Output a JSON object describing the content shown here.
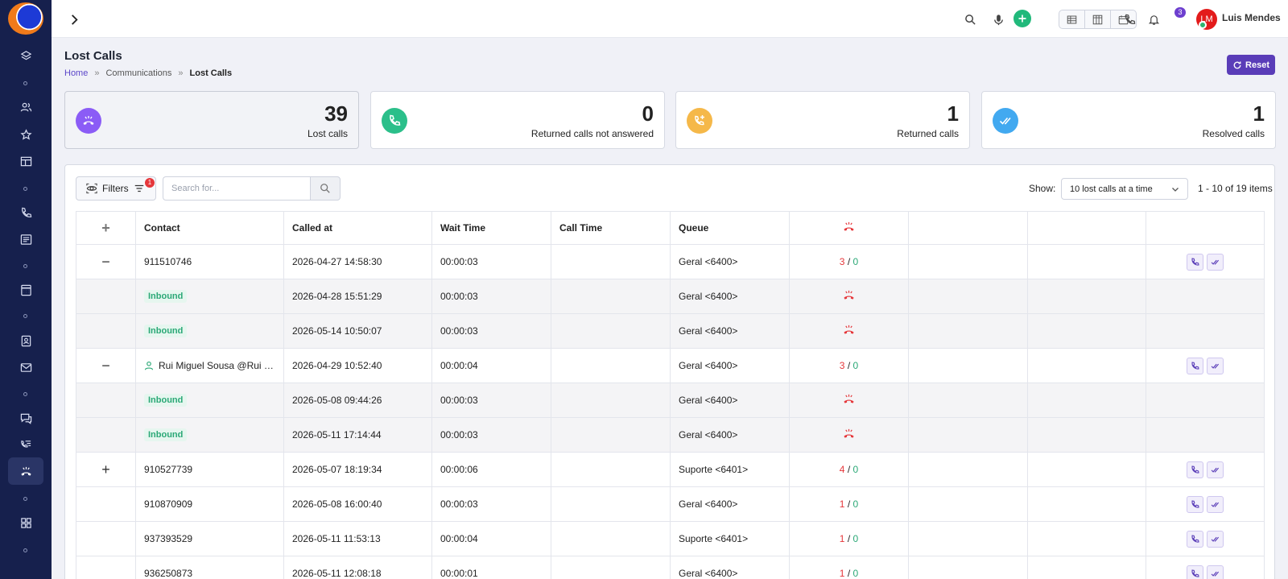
{
  "colors": {
    "sidebar": "#16204d",
    "accent": "#5a3db8",
    "lost": "#e5373b",
    "returned": "#2aa876"
  },
  "sidebar": {
    "items": [
      {
        "name": "layers-icon"
      },
      {
        "name": "users-icon"
      },
      {
        "name": "star-icon"
      },
      {
        "name": "table-icon"
      },
      {
        "name": "phone-icon"
      },
      {
        "name": "list-icon"
      },
      {
        "name": "calculator-icon"
      },
      {
        "name": "contacts-icon"
      },
      {
        "name": "mail-icon"
      },
      {
        "name": "chat-icon"
      },
      {
        "name": "call-list-icon"
      },
      {
        "name": "lost-calls-icon"
      },
      {
        "name": "dashboard-icon"
      }
    ]
  },
  "topbar": {
    "notification_count": "3",
    "avatar_initials": "LM",
    "user_name": "Luis Mendes"
  },
  "page": {
    "title": "Lost Calls",
    "breadcrumb": {
      "home": "Home",
      "section": "Communications",
      "current": "Lost Calls"
    },
    "reset_label": "Reset"
  },
  "stats": [
    {
      "value": "39",
      "label": "Lost calls",
      "icon": "phone-down-icon",
      "color": "#8b5cf6"
    },
    {
      "value": "0",
      "label": "Returned calls not answered",
      "icon": "phone-icon",
      "color": "#2bbf8a"
    },
    {
      "value": "1",
      "label": "Returned calls",
      "icon": "phone-plus-icon",
      "color": "#f5b849"
    },
    {
      "value": "1",
      "label": "Resolved calls",
      "icon": "double-check-icon",
      "color": "#42a9f0"
    }
  ],
  "toolbar": {
    "filters_label": "Filters",
    "filters_count": "1",
    "search_placeholder": "Search for...",
    "show_label": "Show:",
    "show_value": "10 lost calls at a time",
    "range": "1 - 10 of 19 items"
  },
  "table": {
    "columns": {
      "contact": "Contact",
      "called_at": "Called at",
      "wait_time": "Wait Time",
      "call_time": "Call Time",
      "queue": "Queue"
    },
    "expand_all": "+",
    "inbound_label": "Inbound",
    "rows": [
      {
        "expander": "−",
        "contact": "911510746",
        "called_at": "2026-04-27 14:58:30",
        "wait": "00:00:03",
        "queue": "Geral <6400>",
        "lost": "3",
        "returned": "0"
      },
      {
        "sub": true,
        "called_at": "2026-04-28 15:51:29",
        "wait": "00:00:03",
        "queue": "Geral <6400>"
      },
      {
        "sub": true,
        "called_at": "2026-05-14 10:50:07",
        "wait": "00:00:03",
        "queue": "Geral <6400>"
      },
      {
        "expander": "−",
        "contact": "Rui Miguel Sousa @Rui Mi...",
        "contact_icon": true,
        "called_at": "2026-04-29 10:52:40",
        "wait": "00:00:04",
        "queue": "Geral <6400>",
        "lost": "3",
        "returned": "0"
      },
      {
        "sub": true,
        "called_at": "2026-05-08 09:44:26",
        "wait": "00:00:03",
        "queue": "Geral <6400>"
      },
      {
        "sub": true,
        "called_at": "2026-05-11 17:14:44",
        "wait": "00:00:03",
        "queue": "Geral <6400>"
      },
      {
        "expander": "+",
        "contact": "910527739",
        "called_at": "2026-05-07 18:19:34",
        "wait": "00:00:06",
        "queue": "Suporte <6401>",
        "lost": "4",
        "returned": "0"
      },
      {
        "expander": "",
        "contact": "910870909",
        "called_at": "2026-05-08 16:00:40",
        "wait": "00:00:03",
        "queue": "Geral <6400>",
        "lost": "1",
        "returned": "0"
      },
      {
        "expander": "",
        "contact": "937393529",
        "called_at": "2026-05-11 11:53:13",
        "wait": "00:00:04",
        "queue": "Suporte <6401>",
        "lost": "1",
        "returned": "0"
      },
      {
        "expander": "",
        "contact": "936250873",
        "called_at": "2026-05-11 12:08:18",
        "wait": "00:00:01",
        "queue": "Geral <6400>",
        "lost": "1",
        "returned": "0"
      }
    ]
  }
}
